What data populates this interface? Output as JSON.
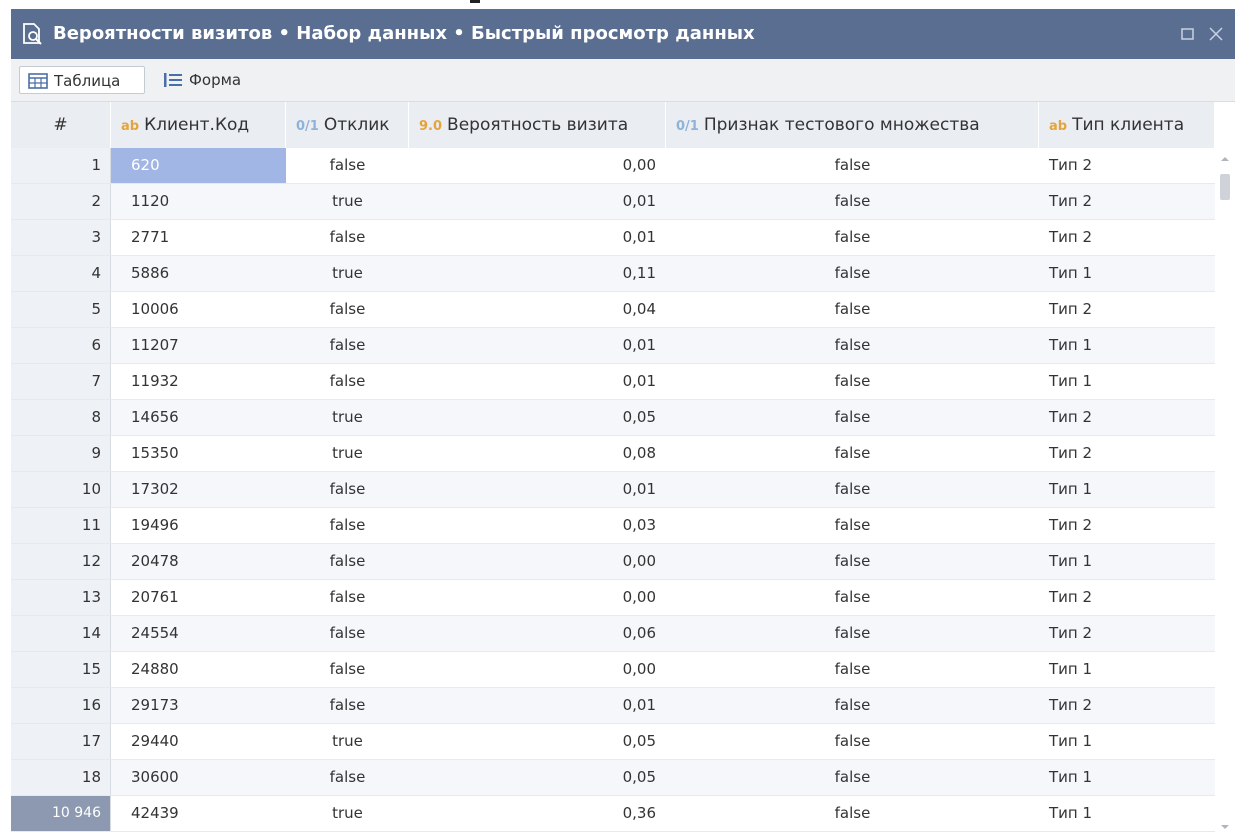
{
  "window": {
    "title": "Вероятности визитов • Набор данных • Быстрый просмотр данных"
  },
  "toolbar": {
    "tabs": [
      {
        "label": "Таблица",
        "icon": "table-grid-icon",
        "active": true
      },
      {
        "label": "Форма",
        "icon": "form-list-icon",
        "active": false
      }
    ]
  },
  "table": {
    "columns": [
      {
        "label": "#",
        "type_badge": ""
      },
      {
        "label": "Клиент.Код",
        "type_badge": "ab"
      },
      {
        "label": "Отклик",
        "type_badge": "0/1"
      },
      {
        "label": "Вероятность визита",
        "type_badge": "9.0"
      },
      {
        "label": "Признак тестового множества",
        "type_badge": "0/1"
      },
      {
        "label": "Тип клиента",
        "type_badge": "ab"
      }
    ],
    "rows": [
      {
        "idx": "1",
        "code": "620",
        "response": "false",
        "prob": "0,00",
        "test": "false",
        "ctype": "Тип 2"
      },
      {
        "idx": "2",
        "code": "1120",
        "response": "true",
        "prob": "0,01",
        "test": "false",
        "ctype": "Тип 2"
      },
      {
        "idx": "3",
        "code": "2771",
        "response": "false",
        "prob": "0,01",
        "test": "false",
        "ctype": "Тип 2"
      },
      {
        "idx": "4",
        "code": "5886",
        "response": "true",
        "prob": "0,11",
        "test": "false",
        "ctype": "Тип 1"
      },
      {
        "idx": "5",
        "code": "10006",
        "response": "false",
        "prob": "0,04",
        "test": "false",
        "ctype": "Тип 2"
      },
      {
        "idx": "6",
        "code": "11207",
        "response": "false",
        "prob": "0,01",
        "test": "false",
        "ctype": "Тип 1"
      },
      {
        "idx": "7",
        "code": "11932",
        "response": "false",
        "prob": "0,01",
        "test": "false",
        "ctype": "Тип 1"
      },
      {
        "idx": "8",
        "code": "14656",
        "response": "true",
        "prob": "0,05",
        "test": "false",
        "ctype": "Тип 2"
      },
      {
        "idx": "9",
        "code": "15350",
        "response": "true",
        "prob": "0,08",
        "test": "false",
        "ctype": "Тип 2"
      },
      {
        "idx": "10",
        "code": "17302",
        "response": "false",
        "prob": "0,01",
        "test": "false",
        "ctype": "Тип 1"
      },
      {
        "idx": "11",
        "code": "19496",
        "response": "false",
        "prob": "0,03",
        "test": "false",
        "ctype": "Тип 2"
      },
      {
        "idx": "12",
        "code": "20478",
        "response": "false",
        "prob": "0,00",
        "test": "false",
        "ctype": "Тип 1"
      },
      {
        "idx": "13",
        "code": "20761",
        "response": "false",
        "prob": "0,00",
        "test": "false",
        "ctype": "Тип 2"
      },
      {
        "idx": "14",
        "code": "24554",
        "response": "false",
        "prob": "0,06",
        "test": "false",
        "ctype": "Тип 2"
      },
      {
        "idx": "15",
        "code": "24880",
        "response": "false",
        "prob": "0,00",
        "test": "false",
        "ctype": "Тип 1"
      },
      {
        "idx": "16",
        "code": "29173",
        "response": "false",
        "prob": "0,01",
        "test": "false",
        "ctype": "Тип 2"
      },
      {
        "idx": "17",
        "code": "29440",
        "response": "true",
        "prob": "0,05",
        "test": "false",
        "ctype": "Тип 1"
      },
      {
        "idx": "18",
        "code": "30600",
        "response": "false",
        "prob": "0,05",
        "test": "false",
        "ctype": "Тип 1"
      },
      {
        "idx": "10 946",
        "code": "42439",
        "response": "true",
        "prob": "0,36",
        "test": "false",
        "ctype": "Тип 1"
      }
    ]
  },
  "colors": {
    "titlebar": "#5a6e91",
    "selected_cell": "#a2b6e6",
    "type_badge_text": "#e5a43a",
    "type_badge_bool": "#8fb3d8"
  }
}
